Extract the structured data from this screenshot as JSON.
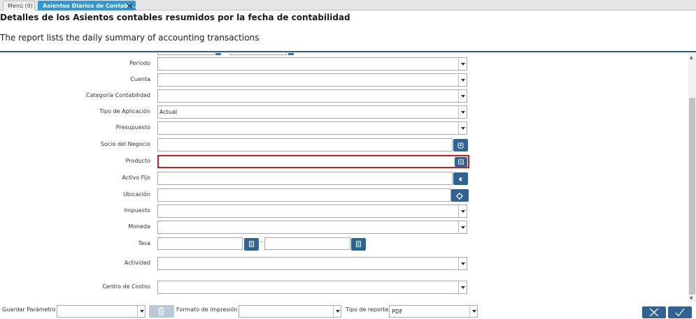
{
  "tabs": [
    {
      "label": "Menú (9)"
    },
    {
      "label": "Asientos Diarios de Contabi..."
    }
  ],
  "header": {
    "title": "Detalles de los Asientos contables resumidos por la fecha de contabilidad",
    "subtitle": "The report lists the daily summary of accounting transactions"
  },
  "fields": {
    "periodo": {
      "label": "Período",
      "value": ""
    },
    "cuenta": {
      "label": "Cuenta",
      "value": ""
    },
    "categoria": {
      "label": "Categoría Contabilidad",
      "value": ""
    },
    "tipo_aplicacion": {
      "label": "Tipo de Aplicación",
      "value": "Actual"
    },
    "presupuesto": {
      "label": "Presupuesto",
      "value": ""
    },
    "socio": {
      "label": "Socio del Negocio",
      "value": ""
    },
    "producto": {
      "label": "Producto",
      "value": ""
    },
    "activo_fijo": {
      "label": "Activo Fijo",
      "value": ""
    },
    "ubicacion": {
      "label": "Ubicación",
      "value": ""
    },
    "impuesto": {
      "label": "Impuesto",
      "value": ""
    },
    "moneda": {
      "label": "Moneda",
      "value": ""
    },
    "tasa": {
      "label": "Tasa",
      "from": "",
      "separator": "-",
      "to": ""
    },
    "actividad": {
      "label": "Actividad",
      "value": ""
    },
    "centro_costos": {
      "label": "Centro de Costos",
      "value": ""
    }
  },
  "footer": {
    "guardar_label": "Guardar Parámetro",
    "guardar_value": "",
    "formato_label": "Formato de impresión",
    "formato_value": "",
    "tipo_label": "Tipo de reporte",
    "tipo_value": "PDF"
  },
  "colors": {
    "accent": "#2d9ad6",
    "button": "#2f6398",
    "error": "#d11a1a"
  }
}
